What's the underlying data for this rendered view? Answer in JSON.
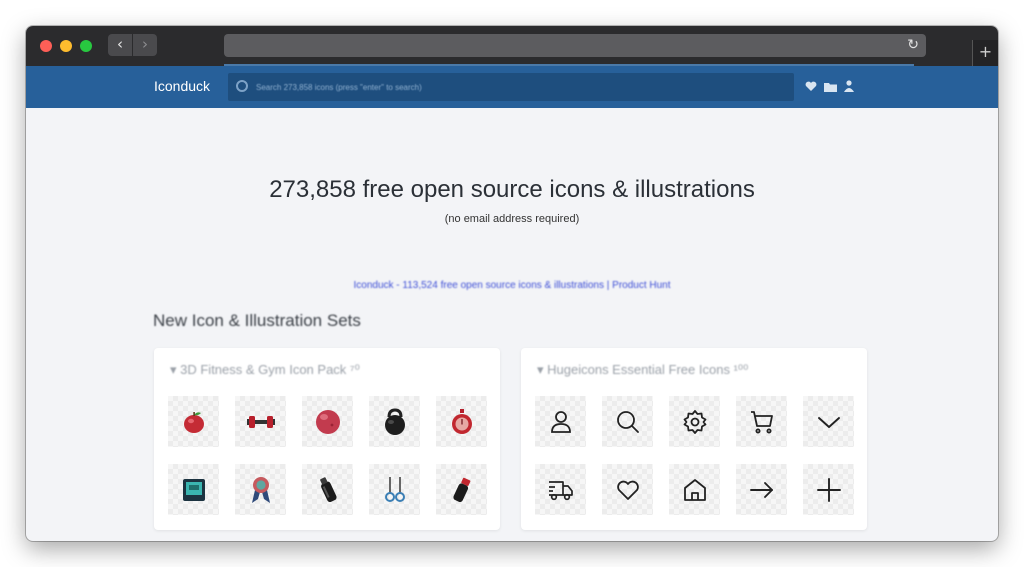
{
  "browser": {
    "back_glyph": "‹",
    "forward_glyph": "›",
    "reload_glyph": "↻",
    "newtab_glyph": "+"
  },
  "site": {
    "logo": "Iconduck",
    "search_placeholder": "Search 273,858 icons (press \"enter\" to search)",
    "header_icons": [
      "heart-icon",
      "folder-icon",
      "user-icon"
    ],
    "brand_color": "#27609a"
  },
  "main": {
    "headline": "273,858 free open source icons & illustrations",
    "subline": "(no email address required)",
    "producthunt_link": "Iconduck - 113,524 free open source icons & illustrations | Product Hunt",
    "section_title": "New Icon & Illustration Sets"
  },
  "sets": [
    {
      "title": "▾ 3D Fitness & Gym Icon Pack ⁷⁰",
      "icons": [
        "apple-icon",
        "dumbbell-icon",
        "yoga-ball-icon",
        "kettlebell-icon",
        "stopwatch-icon",
        "scale-icon",
        "medal-icon",
        "water-bottle-icon",
        "gym-rings-icon",
        "shaker-bottle-icon"
      ]
    },
    {
      "title": "▾ Hugeicons Essential Free Icons ¹⁰⁰",
      "icons": [
        "user-icon",
        "search-icon",
        "settings-icon",
        "cart-icon",
        "chevron-down-icon",
        "delivery-truck-icon",
        "heart-icon",
        "home-icon",
        "arrow-right-icon",
        "plus-icon"
      ]
    }
  ]
}
